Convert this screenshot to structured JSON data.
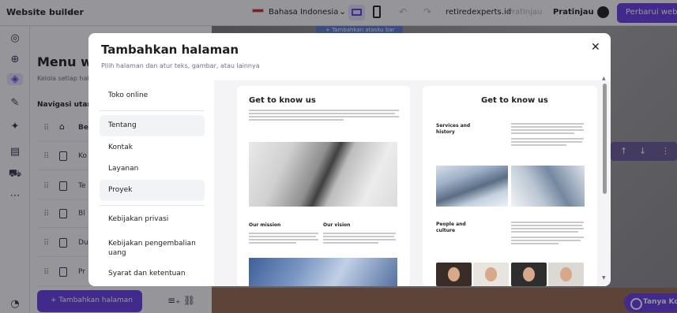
{
  "topbar": {
    "brand": "Website builder",
    "language": "Bahasa Indonesia",
    "domain": "retiredexperts.id",
    "simulate": "Pratinjau",
    "preview": "Pratinjau",
    "update": "Perbarui websi"
  },
  "panel": {
    "title": "Menu we",
    "subtitle": "Kelola setiap hal",
    "nav_heading": "Navigasi utama",
    "rows": [
      "Be",
      "Ko",
      "Te",
      "Bl",
      "Du",
      "Pr"
    ],
    "add_button": "+  Tambahkan halaman"
  },
  "canvas": {
    "strip_label": "+ Tambahkan atasku bar",
    "ask_button": "Tanya Kode"
  },
  "modal": {
    "title": "Tambahkan halaman",
    "subtitle": "Pilih halaman dan atur teks, gambar, atau lainnya",
    "items": [
      {
        "label": "Toko online"
      },
      {
        "label": "Tentang"
      },
      {
        "label": "Kontak"
      },
      {
        "label": "Layanan"
      },
      {
        "label": "Proyek"
      },
      {
        "label": "Kebijakan privasi"
      },
      {
        "label": "Kebijakan pengembalian uang"
      },
      {
        "label": "Syarat dan ketentuan"
      }
    ],
    "selected": [
      "Tentang",
      "Proyek"
    ],
    "template1": {
      "heading": "Get to know us",
      "mission": "Our mission",
      "vision": "Our vision"
    },
    "template2": {
      "heading": "Get to know us",
      "services": "Services and history",
      "people": "People and culture"
    }
  },
  "colors": {
    "accent": "#673de6",
    "accent_light": "#ebe4ff",
    "selected_bg": "#f2f3f6"
  }
}
